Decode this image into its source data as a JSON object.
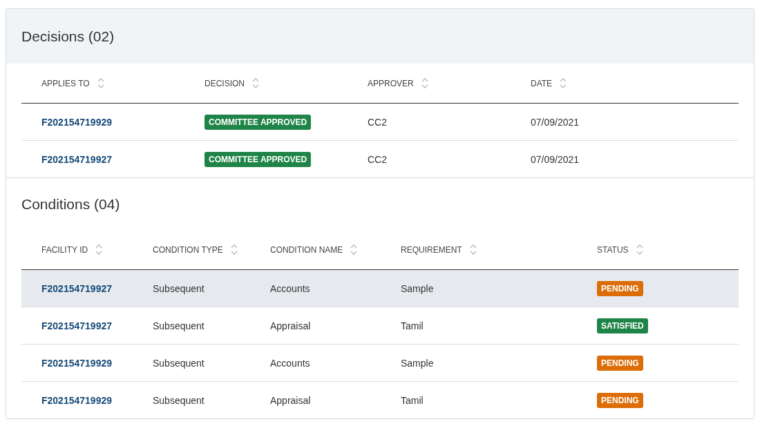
{
  "decisions": {
    "title": "Decisions (02)",
    "columns": [
      "APPLIES TO",
      "DECISION",
      "APPROVER",
      "DATE"
    ],
    "rows": [
      {
        "applies_to": "F202154719929",
        "decision": {
          "label": "COMMITTEE APPROVED",
          "kind": "approved"
        },
        "approver": "CC2",
        "date": "07/09/2021"
      },
      {
        "applies_to": "F202154719927",
        "decision": {
          "label": "COMMITTEE APPROVED",
          "kind": "approved"
        },
        "approver": "CC2",
        "date": "07/09/2021"
      }
    ]
  },
  "conditions": {
    "title": "Conditions (04)",
    "columns": [
      "FACILITY ID",
      "CONDITION TYPE",
      "CONDITION NAME",
      "REQUIREMENT",
      "STATUS"
    ],
    "rows": [
      {
        "facility_id": "F202154719927",
        "condition_type": "Subsequent",
        "condition_name": "Accounts",
        "requirement": "Sample",
        "status": {
          "label": "PENDING",
          "kind": "pending"
        },
        "selected": true
      },
      {
        "facility_id": "F202154719927",
        "condition_type": "Subsequent",
        "condition_name": "Appraisal",
        "requirement": "Tamil",
        "status": {
          "label": "SATISFIED",
          "kind": "satisfied"
        },
        "selected": false
      },
      {
        "facility_id": "F202154719929",
        "condition_type": "Subsequent",
        "condition_name": "Accounts",
        "requirement": "Sample",
        "status": {
          "label": "PENDING",
          "kind": "pending"
        },
        "selected": false
      },
      {
        "facility_id": "F202154719929",
        "condition_type": "Subsequent",
        "condition_name": "Appraisal",
        "requirement": "Tamil",
        "status": {
          "label": "PENDING",
          "kind": "pending"
        },
        "selected": false
      }
    ]
  }
}
